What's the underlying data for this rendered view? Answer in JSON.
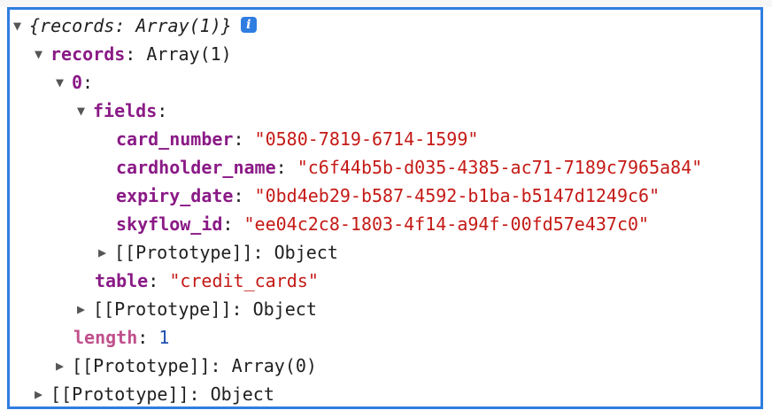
{
  "root": {
    "summary": "{records: Array(1)}",
    "info_glyph": "i"
  },
  "records": {
    "key": "records",
    "value": "Array(1)"
  },
  "item0": {
    "key": "0"
  },
  "fields": {
    "key": "fields",
    "entries": [
      {
        "key": "card_number",
        "value": "\"0580-7819-6714-1599\""
      },
      {
        "key": "cardholder_name",
        "value": "\"c6f44b5b-d035-4385-ac71-7189c7965a84\""
      },
      {
        "key": "expiry_date",
        "value": "\"0bd4eb29-b587-4592-b1ba-b5147d1249c6\""
      },
      {
        "key": "skyflow_id",
        "value": "\"ee04c2c8-1803-4f14-a94f-00fd57e437c0\""
      }
    ],
    "prototype": "[[Prototype]]: Object"
  },
  "table": {
    "key": "table",
    "value": "\"credit_cards\""
  },
  "item0_prototype": "[[Prototype]]: Object",
  "length": {
    "key": "length",
    "value": "1"
  },
  "array_prototype": "[[Prototype]]: Array(0)",
  "root_prototype": "[[Prototype]]: Object",
  "glyphs": {
    "expanded": "▼",
    "collapsed": "▶",
    "colon": ":"
  },
  "colors": {
    "frame_border": "#2f7de1",
    "key": "#8a1a86",
    "string": "#c41a16",
    "number": "#1f4fb0"
  }
}
